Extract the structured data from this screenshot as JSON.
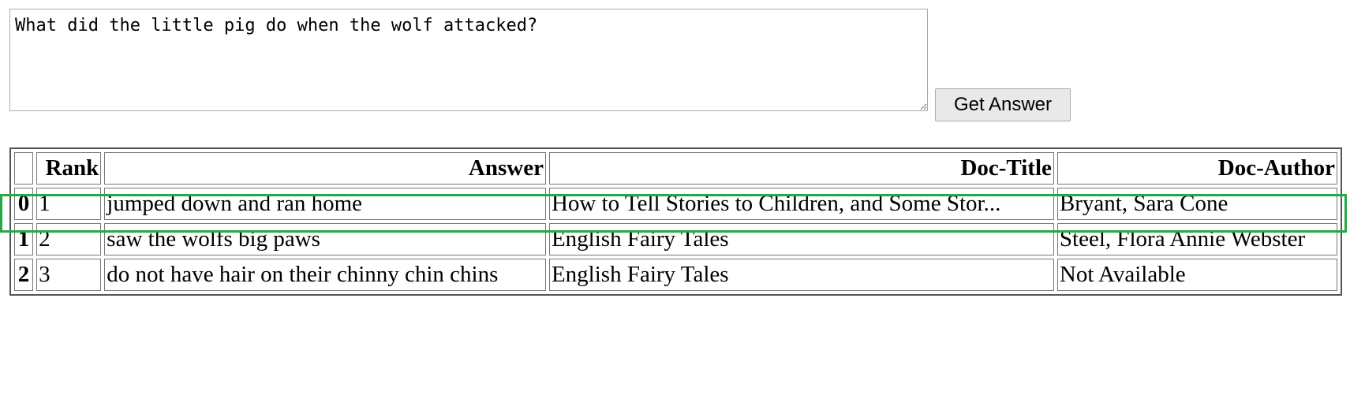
{
  "query": {
    "value": "What did the little pig do when the wolf attacked?"
  },
  "submit": {
    "label": "Get Answer"
  },
  "table": {
    "headers": {
      "index": "",
      "rank": "Rank",
      "answer": "Answer",
      "doc_title": "Doc-Title",
      "doc_author": "Doc-Author"
    },
    "rows": [
      {
        "index": "0",
        "rank": "1",
        "answer": "jumped down and ran home",
        "doc_title": "How to Tell Stories to Children, and Some Stor...",
        "doc_author": "Bryant, Sara Cone"
      },
      {
        "index": "1",
        "rank": "2",
        "answer": "saw the wolfs big paws",
        "doc_title": "English Fairy Tales",
        "doc_author": "Steel, Flora Annie Webster"
      },
      {
        "index": "2",
        "rank": "3",
        "answer": "do not have hair on their chinny chin chins",
        "doc_title": "English Fairy Tales",
        "doc_author": "Not Available"
      }
    ]
  },
  "highlight": {
    "color": "#27a845"
  }
}
